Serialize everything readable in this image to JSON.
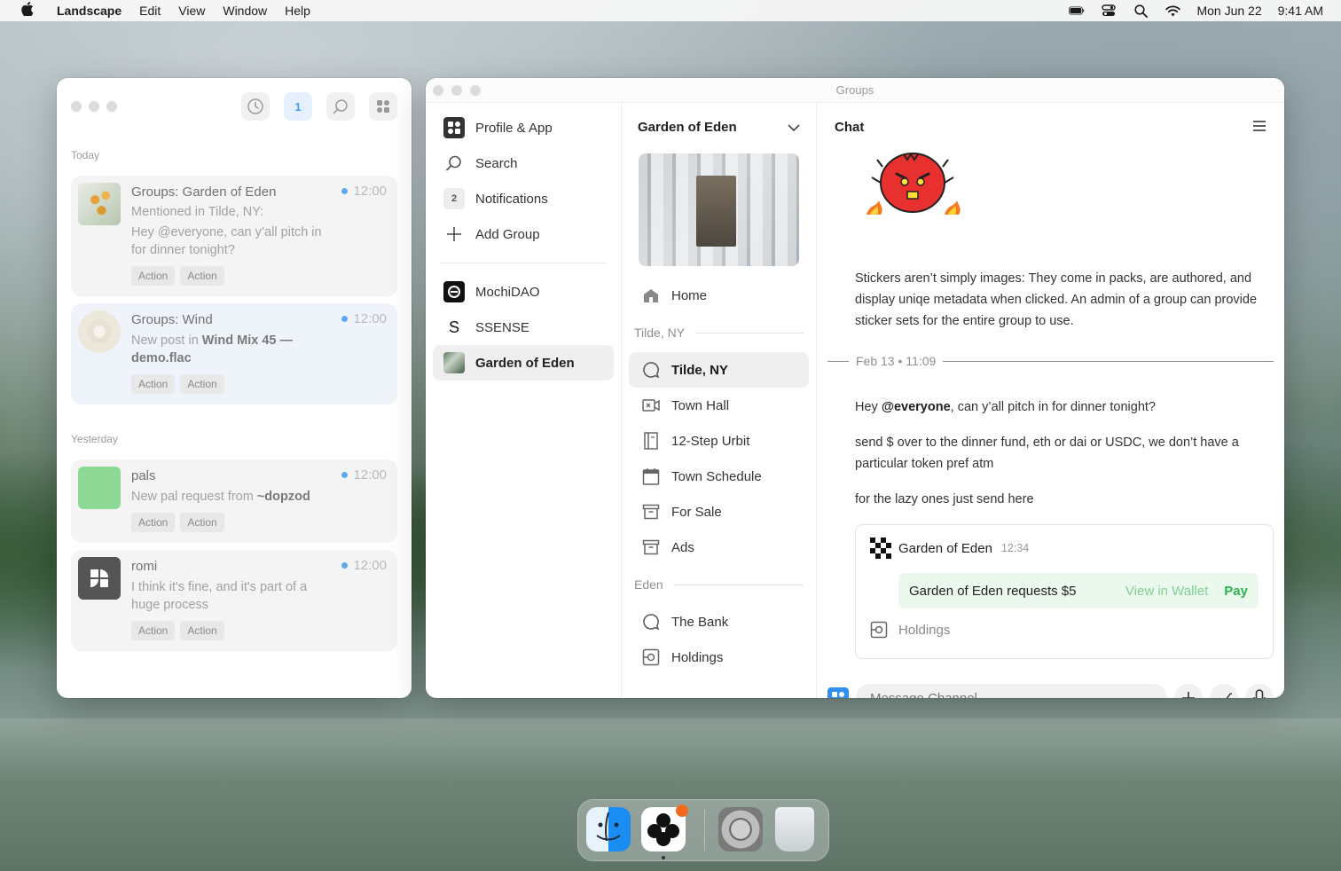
{
  "menubar": {
    "app_name": "Landscape",
    "menus": [
      "Edit",
      "View",
      "Window",
      "Help"
    ],
    "date": "Mon Jun 22",
    "time": "9:41 AM"
  },
  "notifications_window": {
    "badge_count": "1",
    "sections": [
      {
        "label": "Today",
        "items": [
          {
            "title": "Groups: Garden of Eden",
            "sub": "Mentioned in Tilde, NY:",
            "message": "Hey @everyone, can y’all pitch in for dinner tonight?",
            "time": "12:00",
            "actions": [
              "Action",
              "Action"
            ]
          },
          {
            "title": "Groups: Wind",
            "message_prefix": "New post in ",
            "message_bold": "Wind Mix 45 — demo.flac",
            "time": "12:00",
            "actions": [
              "Action",
              "Action"
            ]
          }
        ]
      },
      {
        "label": "Yesterday",
        "items": [
          {
            "title": "pals",
            "message_prefix": "New pal request from ",
            "message_bold": "~dopzod",
            "time": "12:00",
            "actions": [
              "Action",
              "Action"
            ]
          },
          {
            "title": "romi",
            "message": "I think it's fine, and it's part of a huge process",
            "time": "12:00",
            "actions": [
              "Action",
              "Action"
            ]
          }
        ]
      }
    ]
  },
  "groups_window": {
    "title": "Groups",
    "sidebar": {
      "items": [
        {
          "label": "Profile & App",
          "icon": "grid-icon"
        },
        {
          "label": "Search",
          "icon": "search-icon"
        },
        {
          "label": "Notifications",
          "icon": "count-icon",
          "count": "2"
        },
        {
          "label": "Add Group",
          "icon": "plus-icon"
        }
      ],
      "groups": [
        {
          "label": "MochiDAO"
        },
        {
          "label": "SSENSE",
          "glyph": "S"
        },
        {
          "label": "Garden of Eden"
        }
      ]
    },
    "channels": {
      "group_name": "Garden of Eden",
      "home": "Home",
      "sections": [
        {
          "label": "Tilde, NY",
          "items": [
            "Tilde, NY",
            "Town Hall",
            "12-Step Urbit",
            "Town Schedule",
            "For Sale",
            "Ads"
          ]
        },
        {
          "label": "Eden",
          "items": [
            "The Bank",
            "Holdings"
          ]
        }
      ]
    },
    "chat": {
      "header": "Chat",
      "sticker_text": "Stickers aren’t simply images: They come in packs, are authored, and display uniqe metadata when clicked. An admin of a group can provide sticker sets for the entire group to use.",
      "divider": "Feb 13 • 11:09",
      "msg1_prefix": "Hey ",
      "msg1_mention": "@everyone",
      "msg1_suffix": ", can y’all pitch in for dinner tonight?",
      "msg2": "send $ over to the dinner fund, eth or dai or USDC, we don’t have a particular token pref atm",
      "msg3": "for the lazy ones just send here",
      "card": {
        "author": "Garden of Eden",
        "time": "12:34",
        "request": "Garden of Eden requests $5",
        "view_wallet": "View in Wallet",
        "pay": "Pay",
        "holdings": "Holdings"
      },
      "composer_placeholder": "Message Channel"
    }
  },
  "colors": {
    "accent_blue": "#4a9be8",
    "pay_green": "#2fb34b",
    "dock_badge": "#f26b1d"
  }
}
